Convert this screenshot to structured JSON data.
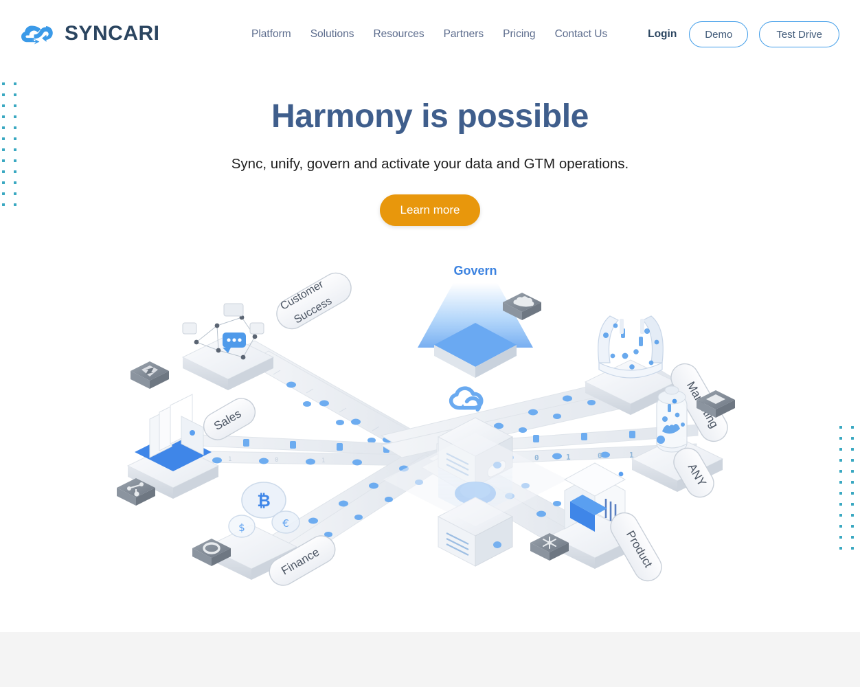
{
  "header": {
    "brand": {
      "name": "SYNCARI",
      "logo_icon": "cloud-sync-icon",
      "logo_color": "#3b9ae8",
      "name_color": "#2b4560"
    },
    "nav": [
      {
        "label": "Platform",
        "name": "platform"
      },
      {
        "label": "Solutions",
        "name": "solutions"
      },
      {
        "label": "Resources",
        "name": "resources"
      },
      {
        "label": "Partners",
        "name": "partners"
      },
      {
        "label": "Pricing",
        "name": "pricing"
      },
      {
        "label": "Contact Us",
        "name": "contact-us"
      }
    ],
    "login_label": "Login",
    "demo_label": "Demo",
    "test_drive_label": "Test Drive",
    "button_border_color": "#3b9ae8"
  },
  "hero": {
    "title": "Harmony is possible",
    "title_color": "#3f5e8c",
    "subtitle": "Sync, unify, govern and activate your data and GTM operations.",
    "cta_label": "Learn more",
    "cta_color": "#e8970c"
  },
  "illustration": {
    "govern_label": "Govern",
    "govern_label_color": "#3b82e0",
    "center_icon": "cloud-sync-icon",
    "nodes": [
      {
        "label": "Customer Success",
        "name": "customer-success",
        "badge_icon": "zendesk-icon"
      },
      {
        "label": "Marketing",
        "name": "marketing",
        "badge_icon": "salesforce-icon"
      },
      {
        "label": "Sales",
        "name": "sales",
        "badge_icon": "hubspot-icon"
      },
      {
        "label": "ANY",
        "name": "any",
        "badge_icon": "generic-app-icon"
      },
      {
        "label": "Finance",
        "name": "finance",
        "badge_icon": "oracle-icon"
      },
      {
        "label": "Product",
        "name": "product",
        "badge_icon": "snowflake-icon"
      }
    ],
    "binary_stream": "1 0 1 0 1 0"
  },
  "decor": {
    "dot_color": "#3aa8c1",
    "dot_rows": 12,
    "dot_cols": 2
  }
}
